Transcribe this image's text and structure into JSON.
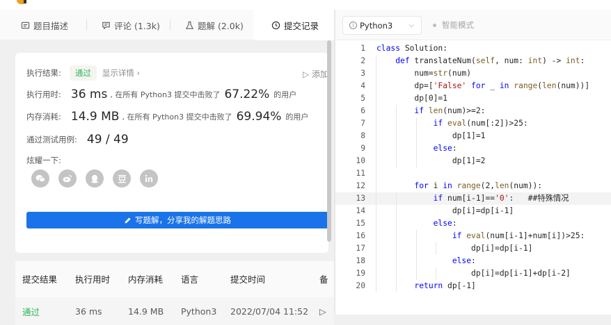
{
  "tabs": [
    {
      "label": "题目描述",
      "icon": "description-icon"
    },
    {
      "label": "评论 (1.3k)",
      "icon": "comment-icon"
    },
    {
      "label": "题解 (2.0k)",
      "icon": "flask-icon"
    },
    {
      "label": "提交记录",
      "icon": "clock-icon"
    }
  ],
  "result": {
    "status_label": "执行结果:",
    "status": "通过",
    "details": "显示详情 ›",
    "add_note": "▷ 添加",
    "runtime_label": "执行用时:",
    "runtime": "36 ms",
    "runtime_text": ", 在所有 Python3 提交中击败了",
    "runtime_pct": "67.22%",
    "runtime_suffix": "的用户",
    "memory_label": "内存消耗:",
    "memory": "14.9 MB",
    "memory_text": ", 在所有 Python3 提交中击败了",
    "memory_pct": "69.94%",
    "memory_suffix": "的用户",
    "cases_label": "通过测试用例:",
    "cases": "49 / 49",
    "share_label": "炫耀一下:",
    "share_icons": [
      "wechat-icon",
      "weibo-icon",
      "qq-icon",
      "douban-icon",
      "linkedin-icon"
    ],
    "write_button": "写题解，分享我的解题思路"
  },
  "submissions": {
    "headers": [
      "提交结果",
      "执行用时",
      "内存消耗",
      "语言",
      "提交时间",
      "备"
    ],
    "rows": [
      [
        "通过",
        "36 ms",
        "14.9 MB",
        "Python3",
        "2022/07/04 11:52",
        "▷"
      ]
    ]
  },
  "editor": {
    "language": "Python3",
    "smart_mode": "智能模式",
    "line_numbers": [
      "1",
      "2",
      "3",
      "4",
      "5",
      "6",
      "7",
      "8",
      "9",
      "10",
      "11",
      "12",
      "13",
      "14",
      "15",
      "16",
      "17",
      "18",
      "19",
      "20"
    ],
    "lines": [
      "class Solution:",
      "    def translateNum(self, num: int) -> int:",
      "        num=str(num)",
      "        dp=['False' for _ in range(len(num))]",
      "        dp[0]=1",
      "        if len(num)>=2:",
      "            if eval(num[:2])>25:",
      "                dp[1]=1",
      "            else:",
      "                dp[1]=2",
      "",
      "        for i in range(2,len(num)):",
      "            if num[i-1]=='0':   ##特殊情况",
      "                dp[i]=dp[i-1]",
      "            else:",
      "                if eval(num[i-1]+num[i])>25:",
      "                    dp[i]=dp[i-1]",
      "                else:",
      "                    dp[i]=dp[i-1]+dp[i-2]",
      "        return dp[-1]"
    ]
  }
}
